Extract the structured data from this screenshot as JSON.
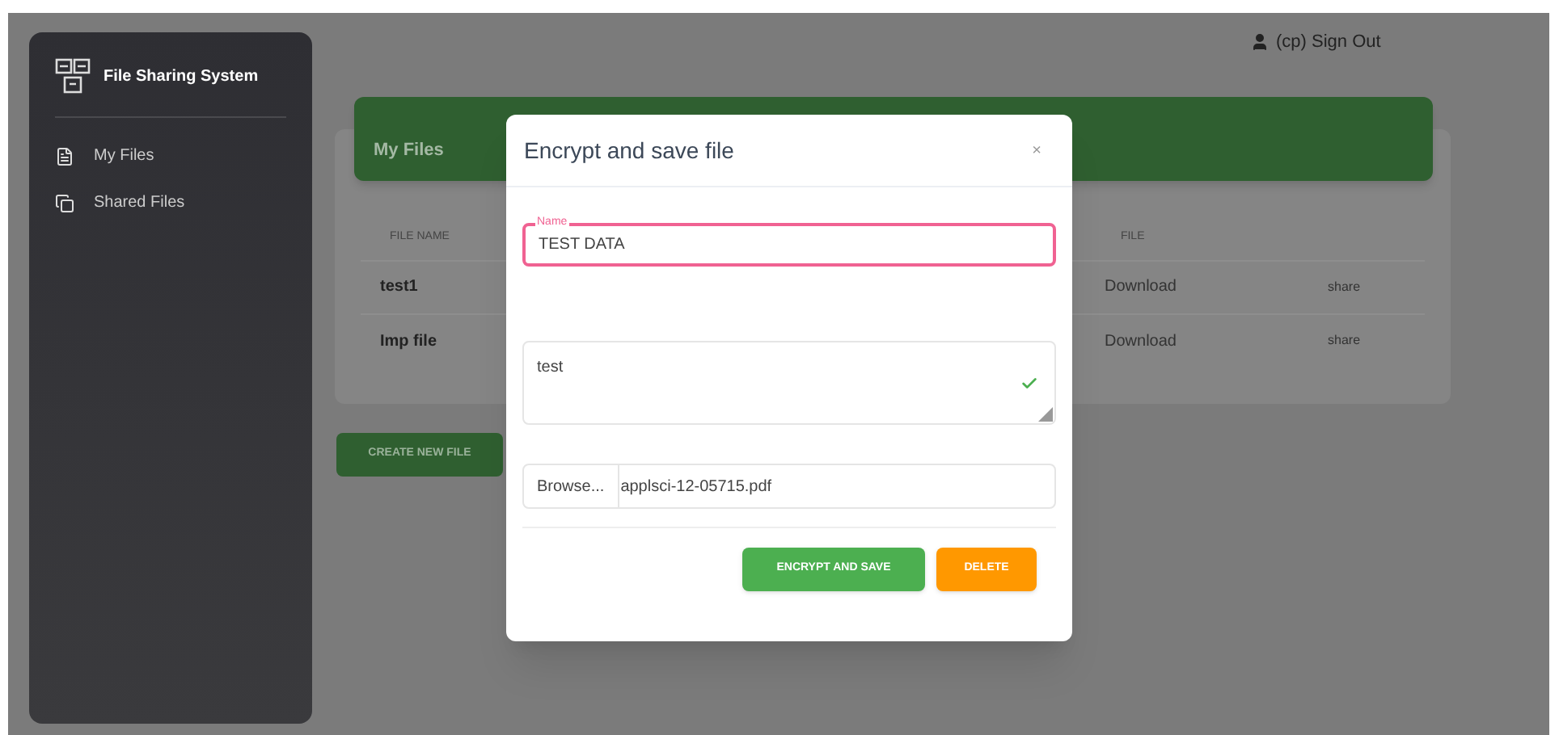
{
  "sidebar": {
    "title": "File Sharing System",
    "items": [
      {
        "label": "My Files"
      },
      {
        "label": "Shared Files"
      }
    ]
  },
  "header": {
    "user": "(cp) Sign Out"
  },
  "files_card": {
    "title": "My Files",
    "columns": [
      "FILE NAME",
      "FILE"
    ],
    "rows": [
      {
        "name": "test1",
        "file": "Download",
        "action": "share"
      },
      {
        "name": "Imp file",
        "file": "Download",
        "action": "share"
      }
    ]
  },
  "create_button": "CREATE NEW FILE",
  "dialog": {
    "title": "Encrypt and save file",
    "close": "×",
    "name_field": {
      "label": "Name",
      "value": "TEST DATA",
      "focused": true
    },
    "description_field": {
      "value": "test",
      "valid": true
    },
    "file_field": {
      "button": "Browse...",
      "value": "applsci-12-05715.pdf"
    },
    "buttons": [
      {
        "label": "ENCRYPT AND SAVE",
        "kind": "primary"
      },
      {
        "label": "DELETE",
        "kind": "warning"
      }
    ]
  }
}
